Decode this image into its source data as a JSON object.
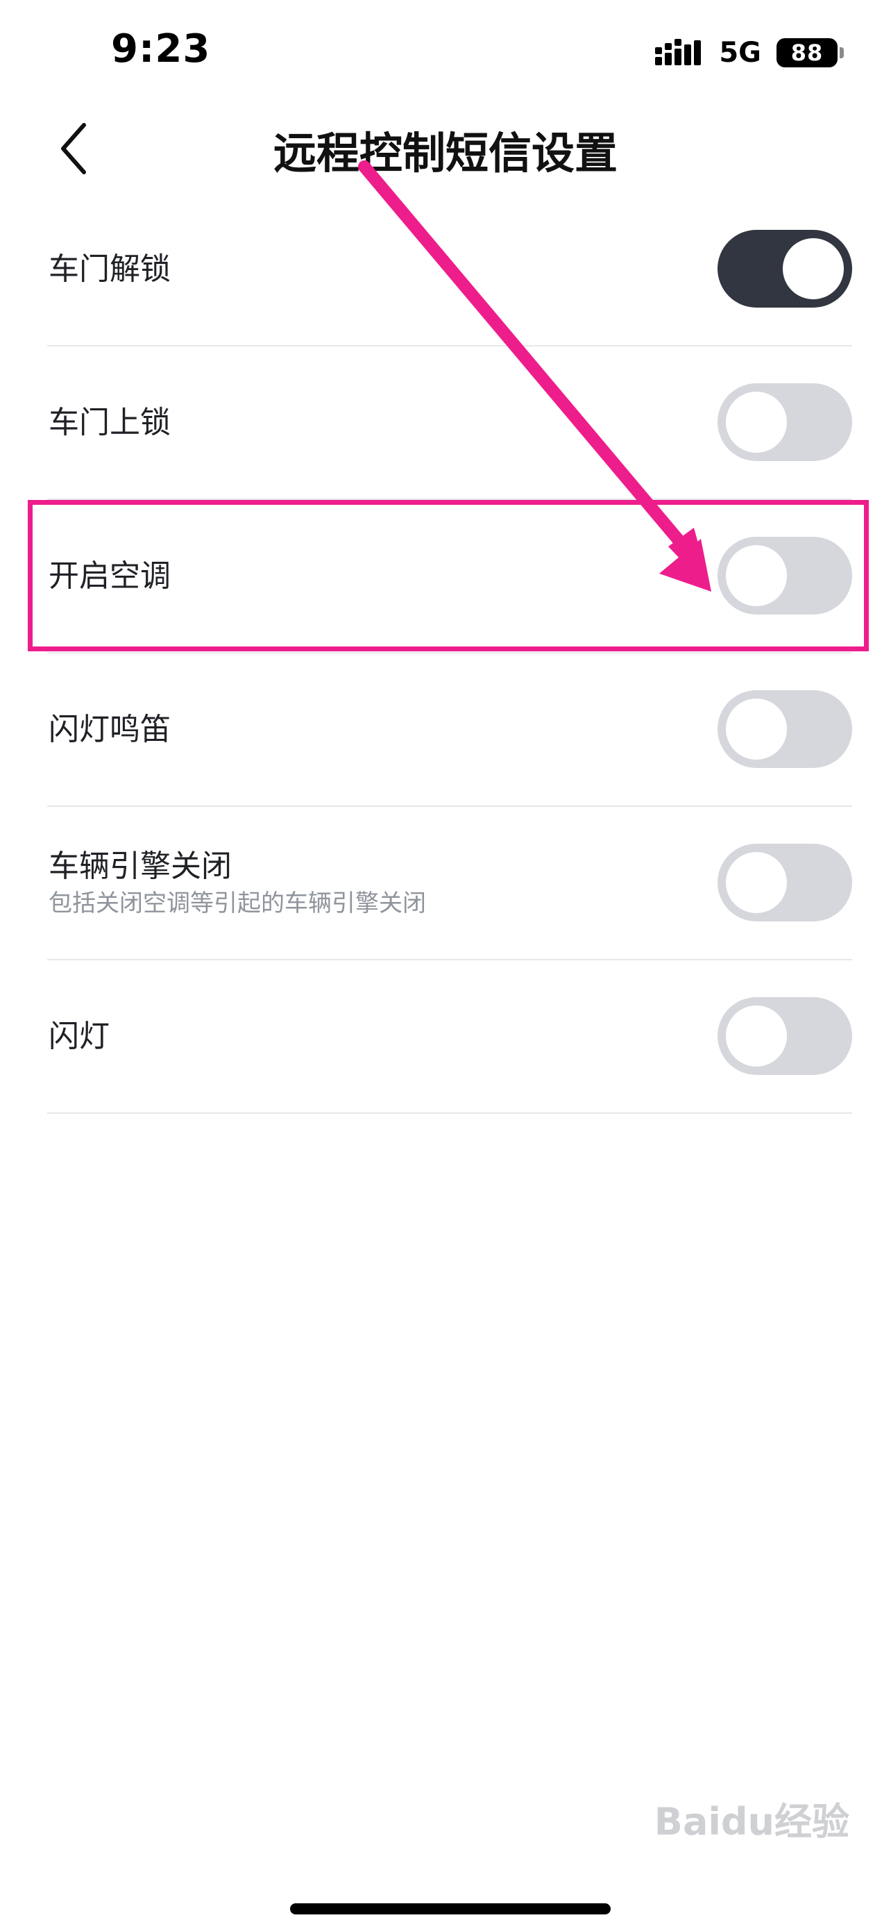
{
  "status_bar": {
    "time": "9:23",
    "network": "5G",
    "battery": "88",
    "signal_icon": "signal-bars-icon"
  },
  "nav": {
    "back_icon": "chevron-left-icon",
    "title": "远程控制短信设置"
  },
  "settings": [
    {
      "label": "车门解锁",
      "on": true
    },
    {
      "label": "车门上锁",
      "on": false
    },
    {
      "label": "开启空调",
      "on": false
    },
    {
      "label": "闪灯鸣笛",
      "on": false
    },
    {
      "label": "车辆引擎关闭",
      "description": "包括关闭空调等引起的车辆引擎关闭",
      "on": false
    },
    {
      "label": "闪灯",
      "on": false
    }
  ],
  "annotation": {
    "color": "#ee1d8c",
    "highlighted_setting": "开启空调"
  },
  "watermark": "Baidu经验"
}
